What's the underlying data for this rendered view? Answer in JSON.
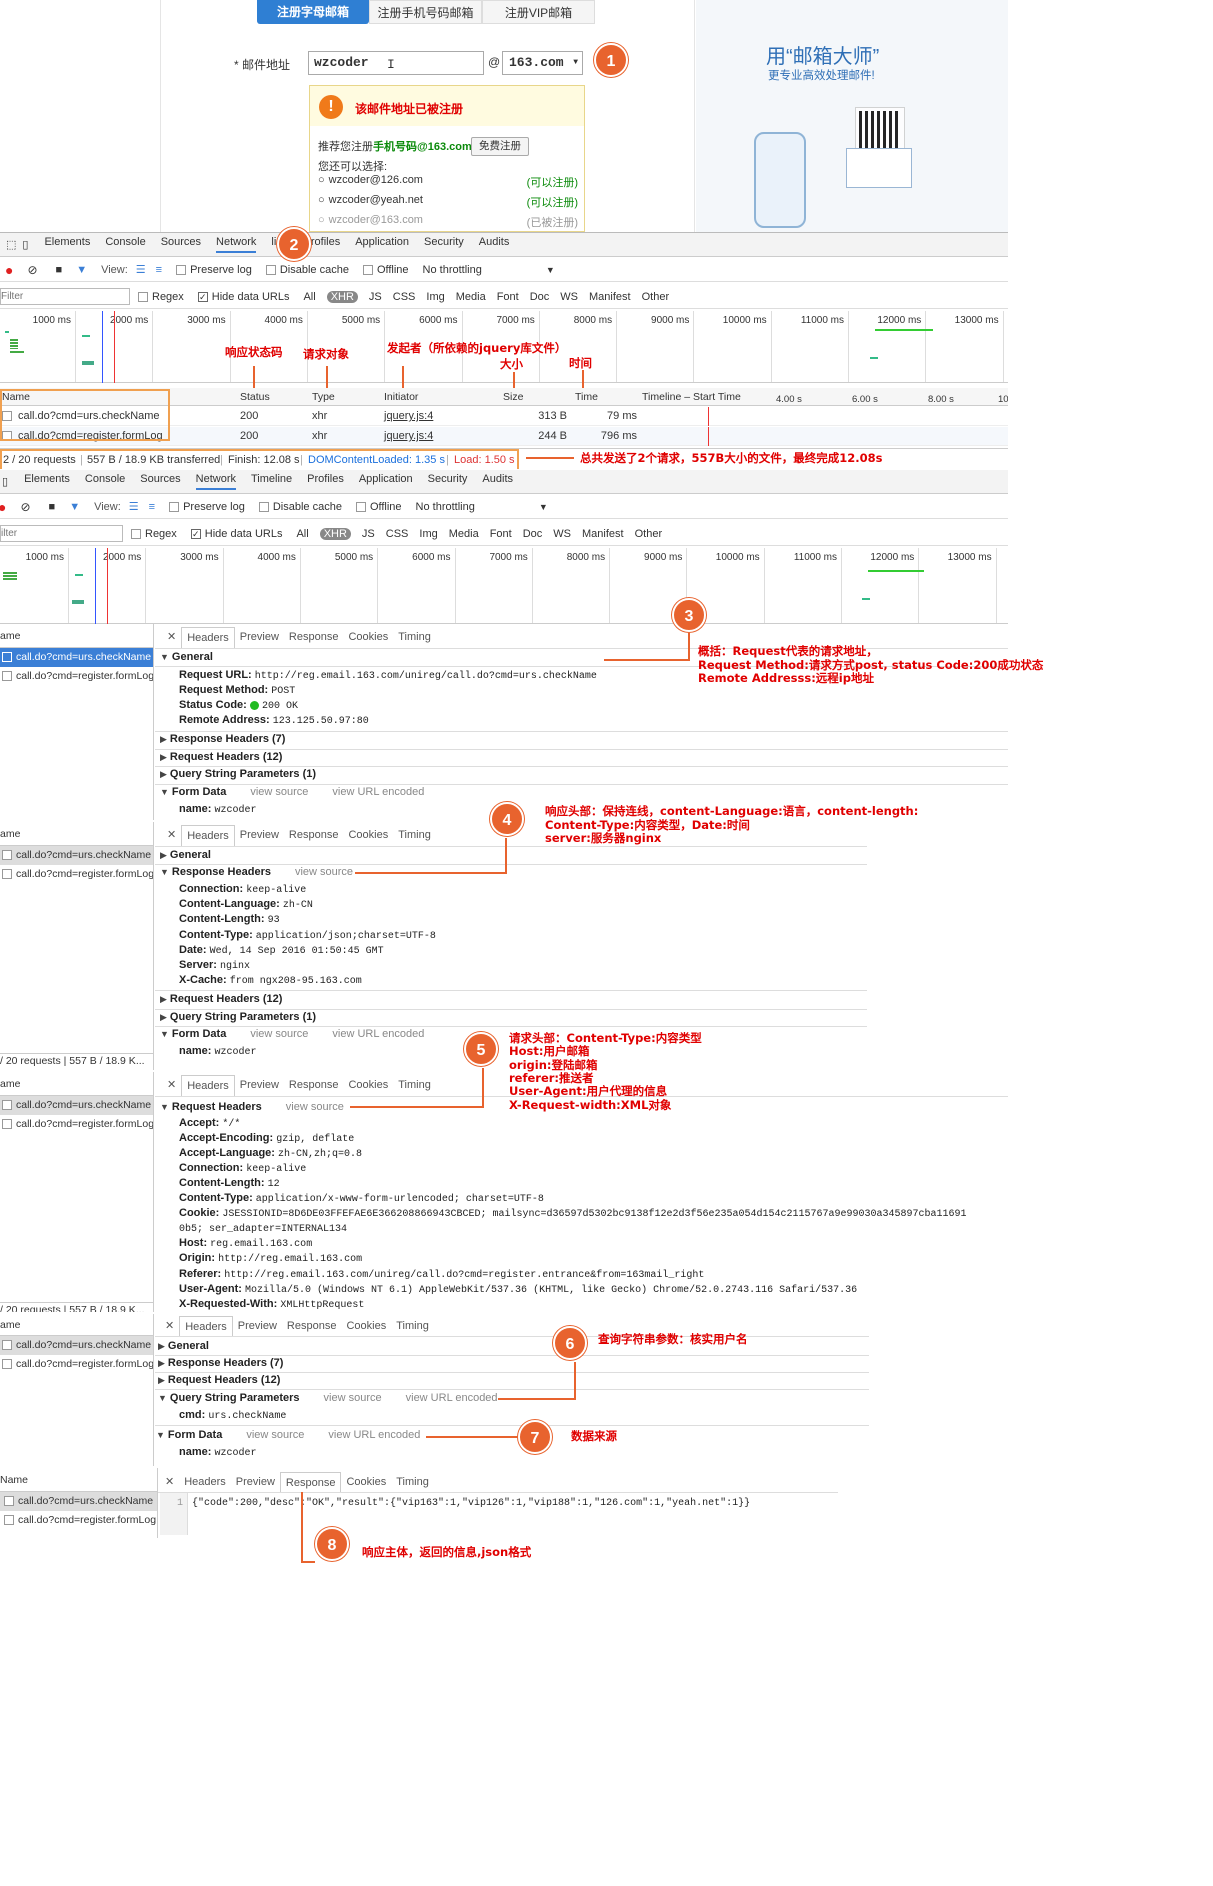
{
  "page": {
    "tabs": [
      "注册字母邮箱",
      "注册手机号码邮箱",
      "注册VIP邮箱"
    ],
    "email_label": "* 邮件地址",
    "email_value": "wzcoder",
    "at": "@",
    "domain_value": "163.com",
    "warning_title": "该邮件地址已被注册",
    "recommend_prefix": "推荐您注册",
    "recommend_highlight": "手机号码@163.com",
    "free_register": "免费注册",
    "alt_prompt": "您还可以选择:",
    "options": [
      {
        "addr": "wzcoder@126.com",
        "status": "(可以注册)"
      },
      {
        "addr": "wzcoder@yeah.net",
        "status": "(可以注册)"
      },
      {
        "addr": "wzcoder@163.com",
        "status": "(已被注册)"
      }
    ],
    "promo_title": "用“邮箱大师”",
    "promo_sub": "更专业高效处理邮件!"
  },
  "devtools": {
    "panels": [
      "Elements",
      "Console",
      "Sources",
      "Network",
      "Timeline",
      "Profiles",
      "Application",
      "Security",
      "Audits"
    ],
    "panels_cut": [
      "Elements",
      "Console",
      "Sources",
      "Network",
      "line",
      "Profiles",
      "Application",
      "Security",
      "Audits"
    ],
    "view": "View:",
    "preserve_log": "Preserve log",
    "disable_cache": "Disable cache",
    "offline": "Offline",
    "throttling": "No throttling",
    "filter_placeholder": "Filter",
    "filter_cut": "ilter",
    "regex": "Regex",
    "hide_data_urls": "Hide data URLs",
    "filter_types": [
      "All",
      "XHR",
      "JS",
      "CSS",
      "Img",
      "Media",
      "Font",
      "Doc",
      "WS",
      "Manifest",
      "Other"
    ],
    "ticks": [
      "1000 ms",
      "2000 ms",
      "3000 ms",
      "4000 ms",
      "5000 ms",
      "6000 ms",
      "7000 ms",
      "8000 ms",
      "9000 ms",
      "10000 ms",
      "11000 ms",
      "12000 ms",
      "13000 ms"
    ],
    "columns": [
      "Name",
      "Status",
      "Type",
      "Initiator",
      "Size",
      "Time",
      "Timeline – Start Time"
    ],
    "timeline_ticks": [
      "4.00 s",
      "6.00 s",
      "8.00 s",
      "10"
    ],
    "requests": [
      {
        "name": "call.do?cmd=urs.checkName",
        "status": "200",
        "type": "xhr",
        "initiator": "jquery.js:4",
        "size": "313 B",
        "time": "79 ms"
      },
      {
        "name": "call.do?cmd=register.formLog",
        "status": "200",
        "type": "xhr",
        "initiator": "jquery.js:4",
        "size": "244 B",
        "time": "796 ms"
      }
    ],
    "summary": {
      "requests": "2 / 20 requests",
      "transferred": "557 B / 18.9 KB transferred",
      "finish": "Finish: 12.08 s",
      "dcl": "DOMContentLoaded: 1.35 s",
      "load": "Load: 1.50 s"
    },
    "summary_short": "/ 20 requests  |  557 B / 18.9 K...",
    "detail_tabs": [
      "Headers",
      "Preview",
      "Response",
      "Cookies",
      "Timing"
    ],
    "name_col": "Name",
    "name_col_cut": "ame",
    "view_source": "view source",
    "view_url_encoded": "view URL encoded",
    "general": {
      "title": "General",
      "request_url_k": "Request URL:",
      "request_url_v": "http://reg.email.163.com/unireg/call.do?cmd=urs.checkName",
      "method_k": "Request Method:",
      "method_v": "POST",
      "status_k": "Status Code:",
      "status_v": "200 OK",
      "remote_k": "Remote Address:",
      "remote_v": "123.125.50.97:80"
    },
    "sections": {
      "response_headers_7": "Response Headers (7)",
      "response_headers": "Response Headers",
      "request_headers_12": "Request Headers (12)",
      "request_headers": "Request Headers",
      "query_params_1": "Query String Parameters (1)",
      "query_params": "Query String Parameters",
      "form_data": "Form Data",
      "general": "General"
    },
    "form_name_k": "name:",
    "form_name_v": "wzcoder",
    "query_cmd_k": "cmd:",
    "query_cmd_v": "urs.checkName",
    "response_headers": [
      {
        "k": "Connection:",
        "v": "keep-alive"
      },
      {
        "k": "Content-Language:",
        "v": "zh-CN"
      },
      {
        "k": "Content-Length:",
        "v": "93"
      },
      {
        "k": "Content-Type:",
        "v": "application/json;charset=UTF-8"
      },
      {
        "k": "Date:",
        "v": "Wed, 14 Sep 2016 01:50:45 GMT"
      },
      {
        "k": "Server:",
        "v": "nginx"
      },
      {
        "k": "X-Cache:",
        "v": "from ngx208-95.163.com"
      }
    ],
    "request_headers": [
      {
        "k": "Accept:",
        "v": "*/*"
      },
      {
        "k": "Accept-Encoding:",
        "v": "gzip, deflate"
      },
      {
        "k": "Accept-Language:",
        "v": "zh-CN,zh;q=0.8"
      },
      {
        "k": "Connection:",
        "v": "keep-alive"
      },
      {
        "k": "Content-Length:",
        "v": "12"
      },
      {
        "k": "Content-Type:",
        "v": "application/x-www-form-urlencoded; charset=UTF-8"
      },
      {
        "k": "Cookie:",
        "v": "JSESSIONID=8D6DE03FFEFAE6E366208866943CBCED; mailsync=d36597d5302bc9138f12e2d3f56e235a054d154c2115767a9e99030a345897cba11691"
      },
      {
        "k": "",
        "v": "0b5; ser_adapter=INTERNAL134"
      },
      {
        "k": "Host:",
        "v": "reg.email.163.com"
      },
      {
        "k": "Origin:",
        "v": "http://reg.email.163.com"
      },
      {
        "k": "Referer:",
        "v": "http://reg.email.163.com/unireg/call.do?cmd=register.entrance&from=163mail_right"
      },
      {
        "k": "User-Agent:",
        "v": "Mozilla/5.0 (Windows NT 6.1) AppleWebKit/537.36 (KHTML, like Gecko) Chrome/52.0.2743.116 Safari/537.36"
      },
      {
        "k": "X-Requested-With:",
        "v": "XMLHttpRequest"
      }
    ],
    "response_line_no": "1",
    "response_body": "{\"code\":200,\"desc\":\"OK\",\"result\":{\"vip163\":1,\"vip126\":1,\"vip188\":1,\"126.com\":1,\"yeah.net\":1}}"
  },
  "annotations": {
    "badges": [
      "1",
      "2",
      "3",
      "4",
      "5",
      "6",
      "7",
      "8"
    ],
    "status_code": "响应状态码",
    "request_object": "请求对象",
    "initiator": "发起者（所依赖的jquery库文件）",
    "size": "大小",
    "time": "时间",
    "summary": "总共发送了2个请求，557B大小的文件，最终完成12.08s",
    "general_lines": [
      "概括：Request代表的请求地址，",
      "Request Method:请求方式post, status Code:200成功状态",
      "Remote Addresss:远程ip地址"
    ],
    "response_lines": [
      "响应头部：保持连线，content-Language:语言，content-length:",
      "Content-Type:内容类型，Date:时间",
      "server:服务器nginx"
    ],
    "request_lines": [
      "请求头部：Content-Type:内容类型",
      "Host:用户邮箱",
      "origin:登陆邮箱",
      "referer:推送者",
      "User-Agent:用户代理的信息",
      "X-Request-width:XML对象"
    ],
    "query": "查询字符串参数：核实用户名",
    "form_source": "数据来源",
    "response_body": "响应主体，返回的信息,json格式"
  },
  "colors": {
    "accent": "#e8632e",
    "annotation": "#e00000",
    "tab_active": "#2f7fd3",
    "summary_border": "#f0a050"
  }
}
